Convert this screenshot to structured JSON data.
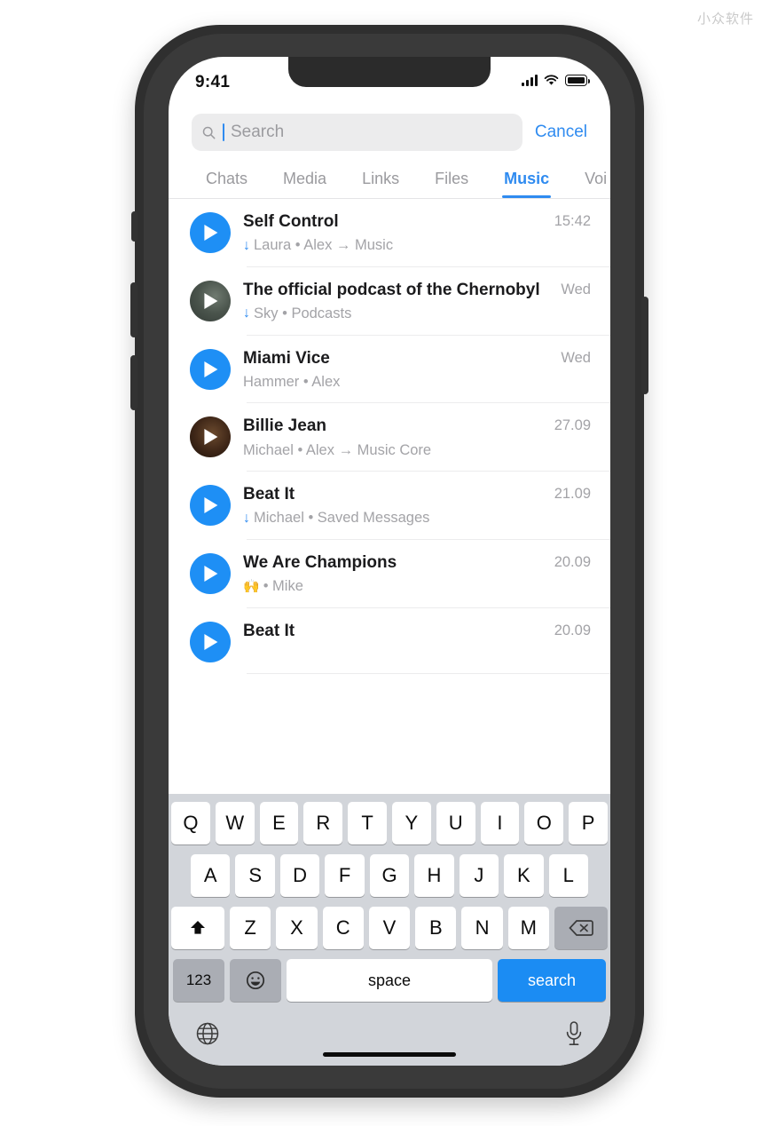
{
  "watermark": "小众软件",
  "status": {
    "time": "9:41",
    "signal_icon": "signal-bars-icon",
    "wifi_icon": "wifi-icon",
    "battery_icon": "battery-full-icon"
  },
  "search": {
    "placeholder": "Search",
    "value": "",
    "cancel_label": "Cancel",
    "icon": "search-icon"
  },
  "tabs": [
    {
      "label": "Chats",
      "active": false
    },
    {
      "label": "Media",
      "active": false
    },
    {
      "label": "Links",
      "active": false
    },
    {
      "label": "Files",
      "active": false
    },
    {
      "label": "Music",
      "active": true
    },
    {
      "label": "Voi",
      "active": false
    }
  ],
  "colors": {
    "accent": "#2f8bf0",
    "play_blue": "#1e8ff5",
    "muted": "#a3a3a7",
    "keyboard_bg": "#d2d5da",
    "search_key": "#1b8cf3"
  },
  "list": [
    {
      "title": "Self Control",
      "downloaded": true,
      "emoji": "",
      "subtitle": "Laura • Alex → Music",
      "time": "15:42",
      "avatar": "play-blue"
    },
    {
      "title": "The official podcast of the Chernobyl",
      "downloaded": true,
      "emoji": "",
      "subtitle": "Sky • Podcasts",
      "time": "Wed",
      "avatar": "photo-green"
    },
    {
      "title": "Miami Vice",
      "downloaded": false,
      "emoji": "",
      "subtitle": "Hammer • Alex",
      "time": "Wed",
      "avatar": "play-blue"
    },
    {
      "title": "Billie Jean",
      "downloaded": false,
      "emoji": "",
      "subtitle": "Michael • Alex → Music Core",
      "time": "27.09",
      "avatar": "photo-brown"
    },
    {
      "title": "Beat It",
      "downloaded": true,
      "emoji": "",
      "subtitle": "Michael • Saved Messages",
      "time": "21.09",
      "avatar": "play-blue"
    },
    {
      "title": "We Are Champions",
      "downloaded": false,
      "emoji": "🙌",
      "subtitle": "• Mike",
      "time": "20.09",
      "avatar": "play-blue"
    },
    {
      "title": "Beat It",
      "downloaded": false,
      "emoji": "",
      "subtitle": "",
      "time": "20.09",
      "avatar": "play-blue"
    }
  ],
  "keyboard": {
    "row1": [
      "Q",
      "W",
      "E",
      "R",
      "T",
      "Y",
      "U",
      "I",
      "O",
      "P"
    ],
    "row2": [
      "A",
      "S",
      "D",
      "F",
      "G",
      "H",
      "J",
      "K",
      "L"
    ],
    "row3": [
      "Z",
      "X",
      "C",
      "V",
      "B",
      "N",
      "M"
    ],
    "shift_icon": "shift-arrow-icon",
    "backspace_icon": "backspace-icon",
    "numbers_label": "123",
    "emoji_icon": "emoji-smiley-icon",
    "space_label": "space",
    "search_label": "search",
    "globe_icon": "globe-icon",
    "mic_icon": "microphone-icon"
  }
}
